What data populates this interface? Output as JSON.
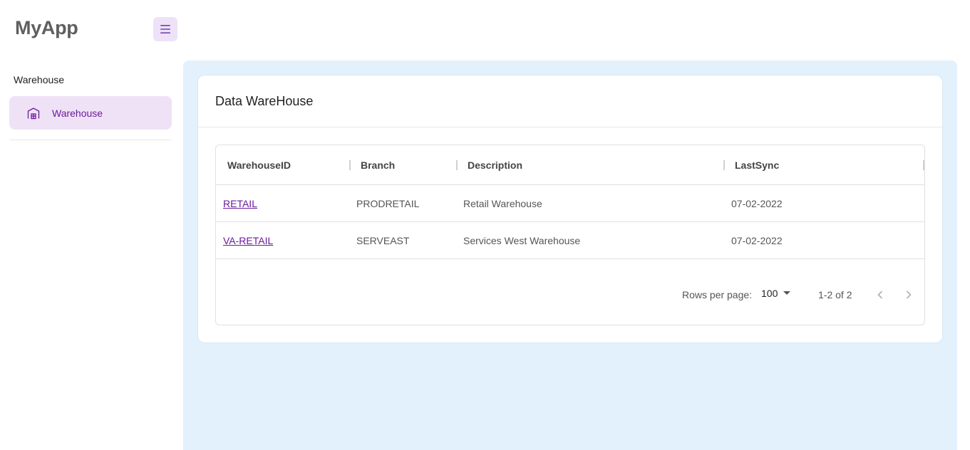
{
  "app": {
    "title": "MyApp"
  },
  "sidebar": {
    "section_label": "Warehouse",
    "items": [
      {
        "label": "Warehouse",
        "icon": "warehouse-icon",
        "active": true
      }
    ]
  },
  "card": {
    "title": "Data WareHouse"
  },
  "table": {
    "columns": [
      "WarehouseID",
      "Branch",
      "Description",
      "LastSync"
    ],
    "rows": [
      {
        "warehouse_id": "RETAIL",
        "branch": "PRODRETAIL",
        "description": "Retail Warehouse",
        "last_sync": "07-02-2022"
      },
      {
        "warehouse_id": "VA-RETAIL",
        "branch": "SERVEAST",
        "description": "Services West Warehouse",
        "last_sync": "07-02-2022"
      }
    ]
  },
  "pagination": {
    "rows_per_page_label": "Rows per page:",
    "rows_per_page_value": "100",
    "range_text": "1-2 of 2"
  },
  "colors": {
    "accent": "#6a1b9a",
    "main_bg": "#e3f1fd",
    "active_item_bg": "#efe2f6"
  }
}
